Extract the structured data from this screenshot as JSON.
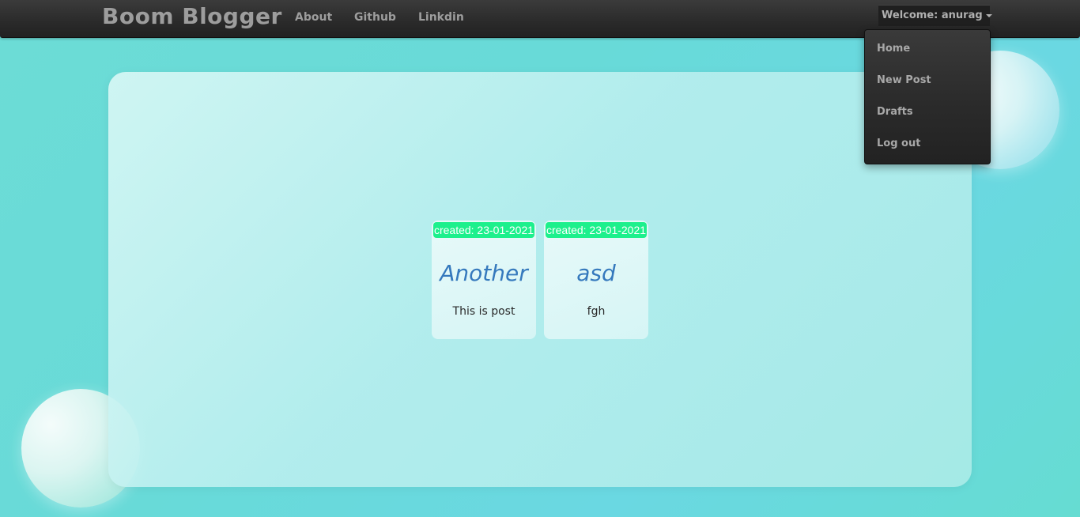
{
  "navbar": {
    "brand": "Boom Blogger",
    "links": [
      {
        "label": "About"
      },
      {
        "label": "Github"
      },
      {
        "label": "Linkdin"
      }
    ],
    "user_menu": {
      "label": "Welcome: anurag",
      "items": [
        {
          "label": "Home"
        },
        {
          "label": "New Post"
        },
        {
          "label": "Drafts"
        },
        {
          "label": "Log out"
        }
      ]
    }
  },
  "posts": [
    {
      "created": "created: 23-01-2021",
      "title": "Another",
      "body": "This is post"
    },
    {
      "created": "created: 23-01-2021",
      "title": "asd",
      "body": "fgh"
    }
  ],
  "colors": {
    "background": "#68dad8",
    "navbar": "#2a2a2a",
    "badge": "#1cf08c",
    "post_title": "#3579bd"
  }
}
